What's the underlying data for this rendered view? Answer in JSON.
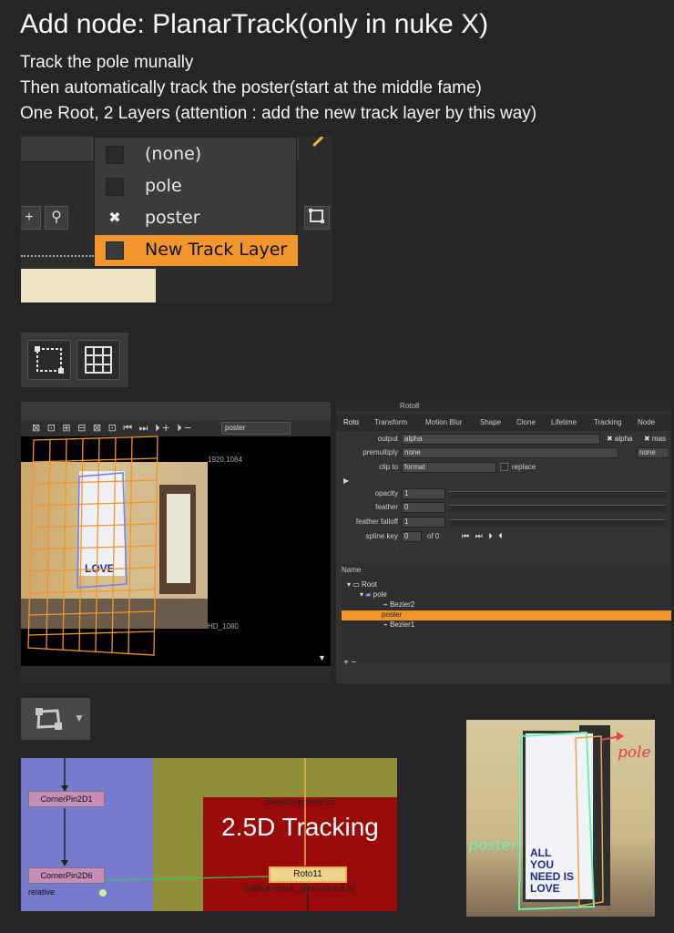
{
  "title": "Add node: PlanarTrack(only in nuke X)",
  "notes": [
    "Track the pole munally",
    "Then automatically track the poster(start at the middle fame)",
    "One Root, 2 Layers (attention : add the new track layer by this way)"
  ],
  "layer_menu": {
    "items": [
      {
        "label": "(none)",
        "checked": false
      },
      {
        "label": "pole",
        "checked": false
      },
      {
        "label": "poster",
        "checked": true,
        "mark": "✖"
      },
      {
        "label": "New Track Layer",
        "highlighted": true
      }
    ],
    "highlight_color": "#f2952c"
  },
  "viewer": {
    "layer_dropdown": "poster",
    "format_top": "1920,1084",
    "format_bottom": "HD_1080",
    "poster_text": "LOVE",
    "toolbar_icons": "⊠ ⊡ ⊞ ⊟  ⊠ ⊡  ⏮ ⏭ ⏵+ ⏵−",
    "scroll_arrow": "▼"
  },
  "properties": {
    "node_name": "Roto8",
    "tabs": [
      "Roto",
      "Transform",
      "Motion Blur",
      "Shape",
      "Clone",
      "Lifetime",
      "Tracking",
      "Node"
    ],
    "output_label": "output",
    "output_value": "alpha",
    "output_checks": [
      "✖ alpha",
      "✖ mas"
    ],
    "premultiply_label": "premultiply",
    "premultiply_value": "none",
    "premultiply_right": "none",
    "clipto_label": "clip to",
    "clipto_value": "format",
    "replace_label": "replace",
    "opacity_label": "opacity",
    "opacity_value": "1",
    "feather_label": "feather",
    "feather_value": "0",
    "feather_falloff_label": "feather falloff",
    "feather_falloff_value": "1",
    "spline_key_label": "spline key",
    "spline_key_value": "0",
    "spline_key_of": "of 0",
    "name_header": "Name",
    "tree": [
      {
        "label": "Root",
        "depth": 0
      },
      {
        "label": "pole",
        "depth": 1
      },
      {
        "label": "Bezier2",
        "depth": 2
      },
      {
        "label": "poster",
        "depth": 1,
        "selected": true
      },
      {
        "label": "Bezier1",
        "depth": 2
      }
    ],
    "add_remove": "+ −"
  },
  "node_graph": {
    "backdrop_label": "BackdropNode15",
    "backdrop_title": "2.5D Tracking",
    "roto_node": "Roto11",
    "roto_sub": "(alpha mask_planartrack.a)",
    "nodes": [
      "CornerPin2D1",
      "CornerPin2D6"
    ],
    "relative_label": "relative",
    "backdrop_color": "#9b0a0a"
  },
  "annotated_photo": {
    "label_pole": "pole",
    "label_poster": "poster",
    "poster_text": [
      "ALL",
      "YOU",
      "NEED IS",
      "LOVE"
    ]
  }
}
